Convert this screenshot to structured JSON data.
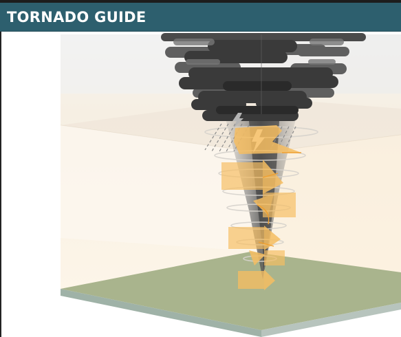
{
  "header": {
    "title": "TORNADO GUIDE"
  },
  "illustration": {
    "subject": "tornado-cross-section",
    "icons": [
      "lightning-icon",
      "lightning-icon",
      "wind-arrow-icon"
    ]
  },
  "colors": {
    "header_bg": "#2d5f6e",
    "header_text": "#ffffff",
    "cloud": "#3f3f3f",
    "wind_arrow": "#f6be62",
    "ground": "#a8b38c",
    "sky_tint": "#fdf2e0"
  }
}
